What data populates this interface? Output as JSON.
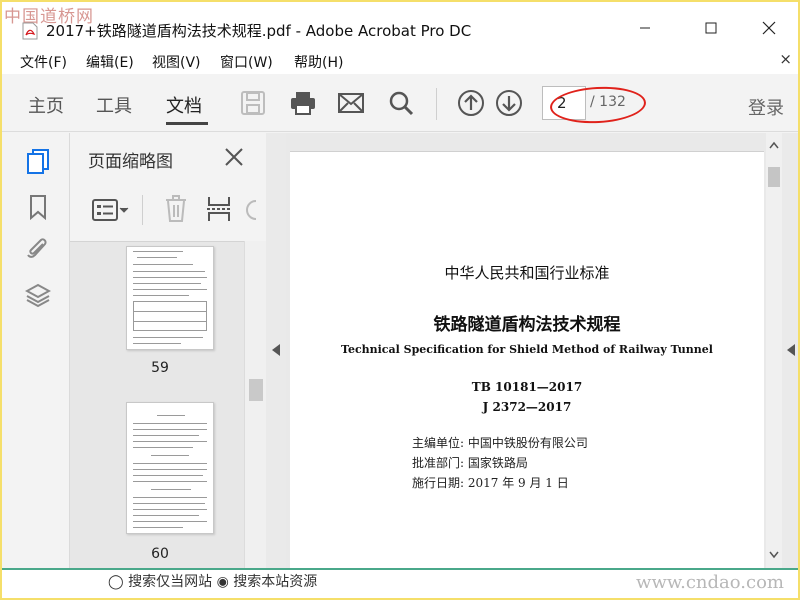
{
  "watermark_top": "中国道桥网",
  "watermark_bottom": "www.cndao.com",
  "window": {
    "title": "2017+铁路隧道盾构法技术规程.pdf - Adobe Acrobat Pro DC"
  },
  "menu": {
    "items": [
      "文件(F)",
      "编辑(E)",
      "视图(V)",
      "窗口(W)",
      "帮助(H)"
    ],
    "close_glyph": "×"
  },
  "toolbar": {
    "tabs": [
      "主页",
      "工具",
      "文档"
    ],
    "active_tab": "文档",
    "icons": [
      "save-icon",
      "print-icon",
      "email-icon",
      "search-icon",
      "prev-page-icon",
      "next-page-icon"
    ],
    "page_current": "2",
    "page_total": "/ 132",
    "login": "登录"
  },
  "rail": {
    "icons": [
      "page-thumbnails-icon",
      "bookmark-icon",
      "attachment-icon",
      "layers-icon"
    ],
    "active_color": "#1473e6"
  },
  "thumbnails": {
    "title": "页面缩略图",
    "pages": [
      {
        "label": "59"
      },
      {
        "label": "60"
      }
    ]
  },
  "document": {
    "line1": "中华人民共和国行业标准",
    "line2": "铁路隧道盾构法技术规程",
    "line3": "Technical Specification for Shield Method of Railway Tunnel",
    "code1": "TB 10181—2017",
    "code2": "J 2372—2017",
    "meta": [
      {
        "label": "主编单位:",
        "value": "中国中铁股份有限公司"
      },
      {
        "label": "批准部门:",
        "value": "国家铁路局"
      },
      {
        "label": "施行日期:",
        "value": "2017 年 9 月 1 日"
      }
    ]
  },
  "bottom": {
    "partial_text": "◯ 搜索仅当网站  ◉ 搜索本站资源"
  }
}
